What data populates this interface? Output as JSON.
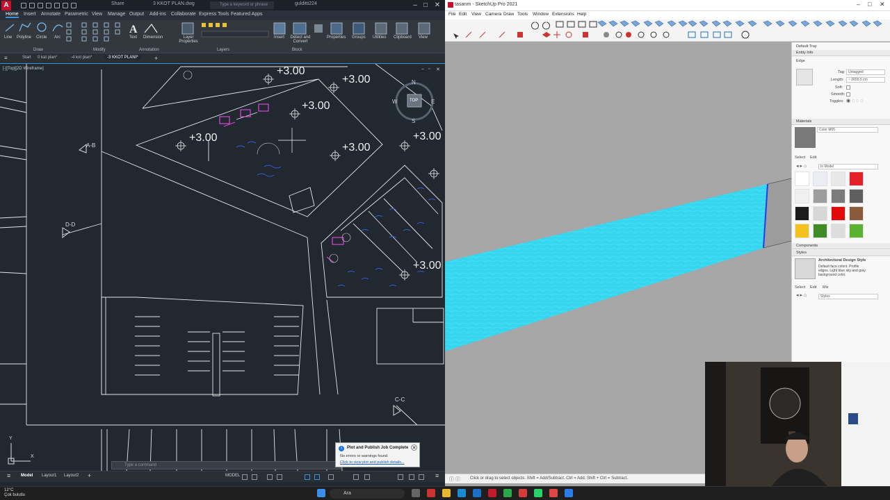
{
  "autocad": {
    "title": "3 KKOT PLAN.dwg",
    "share": "Share",
    "search_placeholder": "Type a keyword or phrase",
    "user": "gulditti224",
    "ribbon_tabs": [
      "Home",
      "Insert",
      "Annotate",
      "Parametric",
      "View",
      "Manage",
      "Output",
      "Add-ins",
      "Collaborate",
      "Express Tools",
      "Featured Apps"
    ],
    "active_tab": "Home",
    "ribbon_tools": {
      "line": "Line",
      "polyline": "Polyline",
      "circle": "Circle",
      "arc": "Arc",
      "text": "Text",
      "dimension": "Dimension",
      "layer_properties": "Layer Properties",
      "insert": "Insert",
      "detect_convert": "Detect and Convert",
      "properties": "Properties",
      "groups": "Groups",
      "utilities": "Utilities",
      "clipboard": "Clipboard",
      "view": "View"
    },
    "ribbon_groups": [
      "Draw",
      "Modify",
      "Annotation",
      "Layers",
      "Block"
    ],
    "doc_tabs": [
      "Start",
      "0 kat plan*",
      "-4 kot plan*",
      "-3 KKOT PLANI*"
    ],
    "viewport_label": "[-][Top][2D Wireframe]",
    "elevations": [
      "+3.00",
      "+3.00",
      "+3.00",
      "+3.00",
      "+3.00",
      "+3.00",
      "+3.00"
    ],
    "section_marks": [
      "A-B",
      "D-D",
      "C-C"
    ],
    "viewcube": {
      "n": "N",
      "s": "S",
      "e": "E",
      "w": "W",
      "top": "TOP"
    },
    "ucs": {
      "y": "Y",
      "x": "X"
    },
    "command_placeholder": "Type a command",
    "layout_tabs": [
      "Model",
      "Layout1",
      "Layout2"
    ],
    "active_layout": "Model",
    "status_model": "MODEL",
    "notification": {
      "title": "Plot and Publish Job Complete",
      "body": "No errors or warnings found",
      "link": "Click to view plot and publish details..."
    }
  },
  "sketchup": {
    "title": "tasarım - SketchUp Pro 2021",
    "menus": [
      "File",
      "Edit",
      "View",
      "Camera",
      "Draw",
      "Tools",
      "Window",
      "Extensions",
      "Help"
    ],
    "tray": {
      "title": "Default Tray",
      "entity_info": {
        "header": "Entity Info",
        "type": "Edge",
        "tag_label": "Tag:",
        "tag_value": "Untagged",
        "length_label": "Length:",
        "length_value": "~ 2655,5 cm",
        "soft_label": "Soft:",
        "smooth_label": "Smooth:",
        "toggles_label": "Toggles:"
      },
      "materials": {
        "header": "Materials",
        "current": "Color M05",
        "select_tab": "Select",
        "edit_tab": "Edit",
        "dropdown": "In Model",
        "swatches": [
          "#ffffff",
          "#eaeef4",
          "#e8e8e8",
          "#e6202a",
          "#f0f0f0",
          "#9d9d9d",
          "#7b7b7b",
          "#5f5f5f",
          "#1c1c1c",
          "#d7d7d7",
          "#e00a0a",
          "#8a5a3a",
          "#f4c21c",
          "#3f8b25",
          "#dddddd",
          "#5bb130"
        ]
      },
      "components_header": "Components",
      "styles": {
        "header": "Styles",
        "name": "Architectural Design Style",
        "description": "Default face colors. Profile edges. Light blue sky and gray background color.",
        "select_tab": "Select",
        "edit_tab": "Edit",
        "mix_tab": "Mix",
        "dropdown": "Styles"
      }
    },
    "status": "Click or drag to select objects. Shift = Add/Subtract. Ctrl = Add. Shift + Ctrl = Subtract."
  },
  "taskbar": {
    "temp": "12°C",
    "weather": "Çok bulutlu",
    "search": "Ara"
  },
  "colors": {
    "acad_bg": "#212830",
    "accent": "#3c8fd8",
    "sk_water": "#35d6ef",
    "sk_ground": "#a7a7a7"
  }
}
